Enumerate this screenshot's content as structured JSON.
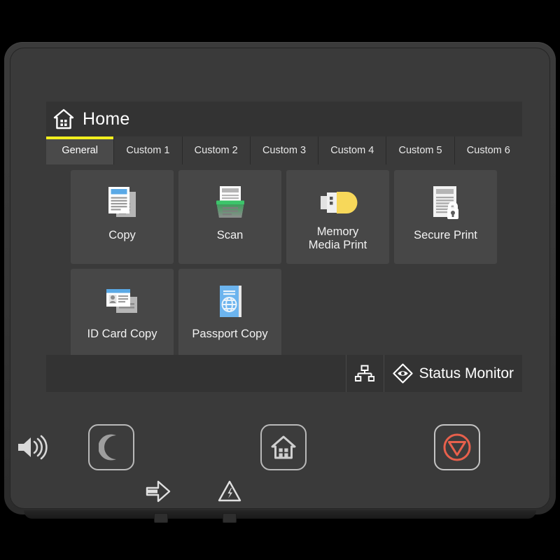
{
  "device": {
    "name": "multifunction-printer-control-panel"
  },
  "screen": {
    "titlebar": {
      "icon": "home-icon",
      "title": "Home"
    },
    "tabs": [
      {
        "label": "General",
        "active": true,
        "accent": "#f2ef1e"
      },
      {
        "label": "Custom 1",
        "active": false
      },
      {
        "label": "Custom 2",
        "active": false
      },
      {
        "label": "Custom 3",
        "active": false
      },
      {
        "label": "Custom 4",
        "active": false
      },
      {
        "label": "Custom 5",
        "active": false
      },
      {
        "label": "Custom 6",
        "active": false
      }
    ],
    "tiles": [
      {
        "label": "Copy",
        "icon": "copy-documents-icon",
        "accent": "#5aa9e6"
      },
      {
        "label": "Scan",
        "icon": "scanner-icon",
        "accent": "#3cc46a"
      },
      {
        "label": "Memory Media Print",
        "icon": "usb-flash-drive-icon",
        "accent": "#f7d85a"
      },
      {
        "label": "Secure Print",
        "icon": "document-lock-icon",
        "accent": "#d6d6d6"
      },
      {
        "label": "ID Card Copy",
        "icon": "id-card-icon",
        "accent": "#5aa9e6"
      },
      {
        "label": "Passport Copy",
        "icon": "passport-book-icon",
        "accent": "#5aa9e6"
      }
    ],
    "statusbar": {
      "network_icon": "network-tree-icon",
      "status_monitor_icon": "eye-diamond-icon",
      "status_monitor_label": "Status Monitor"
    }
  },
  "hardware": {
    "speaker_icon": "volume-speaker-icon",
    "buttons": [
      {
        "name": "sleep-button",
        "icon": "moon-icon"
      },
      {
        "name": "home-button",
        "icon": "home-icon"
      },
      {
        "name": "stop-button",
        "icon": "stop-icon",
        "color": "#e8604c"
      }
    ],
    "indicators": [
      {
        "name": "data-indicator",
        "icon": "data-arrow-icon"
      },
      {
        "name": "error-indicator",
        "icon": "warning-triangle-icon"
      }
    ]
  },
  "colors": {
    "bezel": "#3a3a3a",
    "screen_bg": "#2e2e2e",
    "tile_bg": "#474747",
    "panel_bg": "#3a3a3a",
    "titlebar_bg": "#333333",
    "tab_active_accent": "#f2ef1e",
    "text": "#ffffff",
    "stop_red": "#e8604c"
  }
}
